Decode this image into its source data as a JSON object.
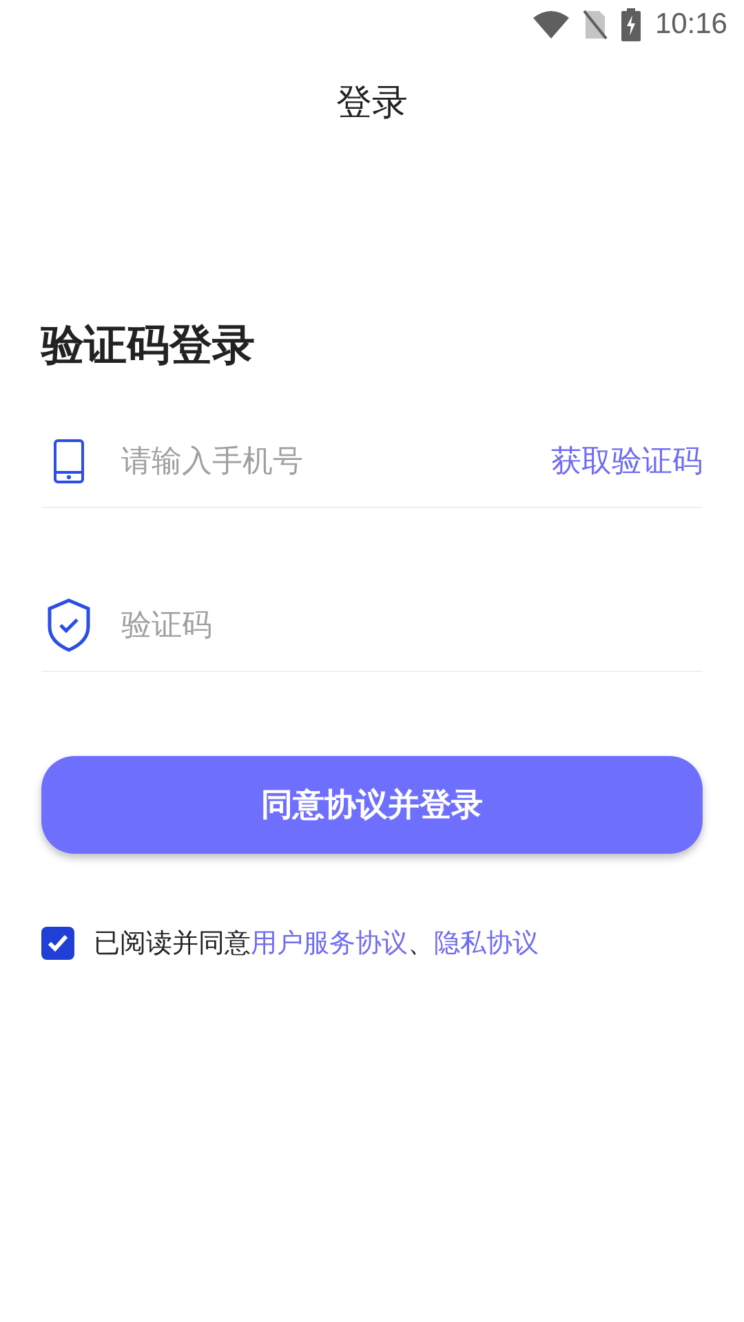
{
  "status_bar": {
    "time": "10:16"
  },
  "header": {
    "title": "登录"
  },
  "heading": "验证码登录",
  "phone_field": {
    "placeholder": "请输入手机号",
    "action": "获取验证码"
  },
  "code_field": {
    "placeholder": "验证码"
  },
  "submit_button": "同意协议并登录",
  "agreement": {
    "checked": true,
    "parts": [
      {
        "kind": "text",
        "text": "已阅读并同意"
      },
      {
        "kind": "link",
        "text": "用户服务协议"
      },
      {
        "kind": "text",
        "text": "、"
      },
      {
        "kind": "link",
        "text": "隐私协议"
      }
    ]
  }
}
